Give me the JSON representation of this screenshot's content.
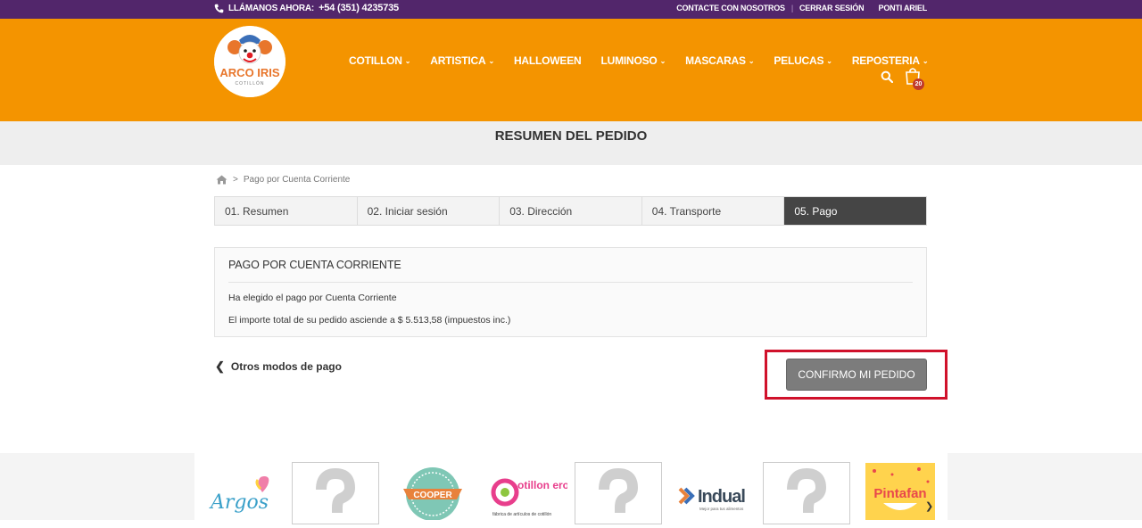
{
  "topbar": {
    "phone_label": "LLÁMANOS AHORA:",
    "phone_number": "+54 (351) 4235735",
    "links": [
      "CONTACTE CON NOSOTROS",
      "CERRAR SESIÓN",
      "PONTI ARIEL"
    ]
  },
  "logo": {
    "line1": "ARCO IRIS",
    "line2": "COTILLÓN"
  },
  "nav": [
    {
      "label": "COTILLON",
      "has_dropdown": true
    },
    {
      "label": "ARTISTICA",
      "has_dropdown": true
    },
    {
      "label": "HALLOWEEN",
      "has_dropdown": false
    },
    {
      "label": "LUMINOSO",
      "has_dropdown": true
    },
    {
      "label": "MASCARAS",
      "has_dropdown": true
    },
    {
      "label": "PELUCAS",
      "has_dropdown": true
    },
    {
      "label": "REPOSTERIA",
      "has_dropdown": true
    }
  ],
  "cart": {
    "count": "20"
  },
  "page_title": "RESUMEN DEL PEDIDO",
  "breadcrumb": {
    "separator": ">",
    "current": "Pago por Cuenta Corriente"
  },
  "steps": [
    {
      "label": "01. Resumen",
      "active": false
    },
    {
      "label": "02. Iniciar sesión",
      "active": false
    },
    {
      "label": "03. Dirección",
      "active": false
    },
    {
      "label": "04. Transporte",
      "active": false
    },
    {
      "label": "05. Pago",
      "active": true
    }
  ],
  "payment": {
    "heading": "PAGO POR CUENTA CORRIENTE",
    "line1": "Ha elegido el pago por Cuenta Corriente",
    "line2": "El importe total de su pedido asciende a $ 5.513,58 (impuestos inc.)"
  },
  "back_link": "Otros modos de pago",
  "confirm_button": "CONFIRMO MI PEDIDO",
  "brands": {
    "argos": "Argos",
    "cooper": "COOPER",
    "cotillon_lero": "otillon ero",
    "cotillon_lero_sub": "fábrica de artículos de cotillón",
    "indual": "Indual",
    "indual_sub": "Mejor para tus alimentos",
    "pintafan": "Pintafan"
  },
  "colors": {
    "topbar": "#52266b",
    "header": "#f49400",
    "active_step": "#454545",
    "highlight": "#d0112b"
  }
}
